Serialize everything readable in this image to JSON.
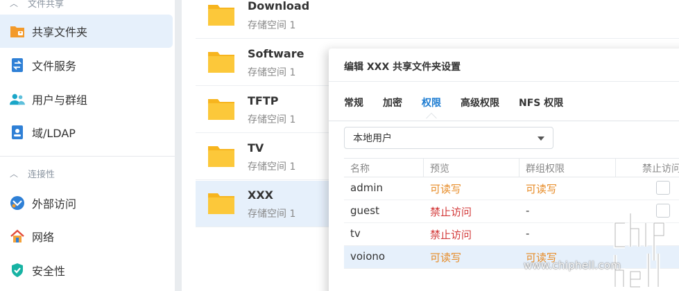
{
  "sidebar": {
    "section_file_sharing": "文件共享",
    "items_top": [
      {
        "label": "共享文件夹",
        "icon": "shared-folder-icon"
      },
      {
        "label": "文件服务",
        "icon": "file-services-icon"
      },
      {
        "label": "用户与群组",
        "icon": "users-groups-icon"
      },
      {
        "label": "域/LDAP",
        "icon": "domain-ldap-icon"
      }
    ],
    "section_connectivity": "连接性",
    "items_bottom": [
      {
        "label": "外部访问",
        "icon": "external-access-icon"
      },
      {
        "label": "网络",
        "icon": "network-icon"
      },
      {
        "label": "安全性",
        "icon": "security-icon"
      }
    ]
  },
  "folders": [
    {
      "name": "Download",
      "volume": "存储空间 1"
    },
    {
      "name": "Software",
      "volume": "存储空间 1"
    },
    {
      "name": "TFTP",
      "volume": "存储空间 1"
    },
    {
      "name": "TV",
      "volume": "存储空间 1"
    },
    {
      "name": "XXX",
      "volume": "存储空间 1"
    }
  ],
  "dialog": {
    "title": "编辑 XXX 共享文件夹设置",
    "tabs": [
      "常规",
      "加密",
      "权限",
      "高级权限",
      "NFS 权限"
    ],
    "active_tab": "权限",
    "user_type": "本地用户",
    "columns": [
      "名称",
      "预览",
      "群组权限",
      "禁止访问"
    ],
    "rows": [
      {
        "name": "admin",
        "preview": "可读写",
        "group": "可读写"
      },
      {
        "name": "guest",
        "preview": "禁止访问",
        "group": "-"
      },
      {
        "name": "tv",
        "preview": "禁止访问",
        "group": "-"
      },
      {
        "name": "voiono",
        "preview": "可读写",
        "group": "可读写"
      }
    ]
  },
  "watermark": {
    "url": "www.chiphell.com"
  },
  "colors": {
    "accent": "#1b7bd1",
    "read_write": "#e78b26",
    "deny": "#d33a3a",
    "folder": "#f7c02e",
    "selected_bg": "#e6f0fb"
  }
}
